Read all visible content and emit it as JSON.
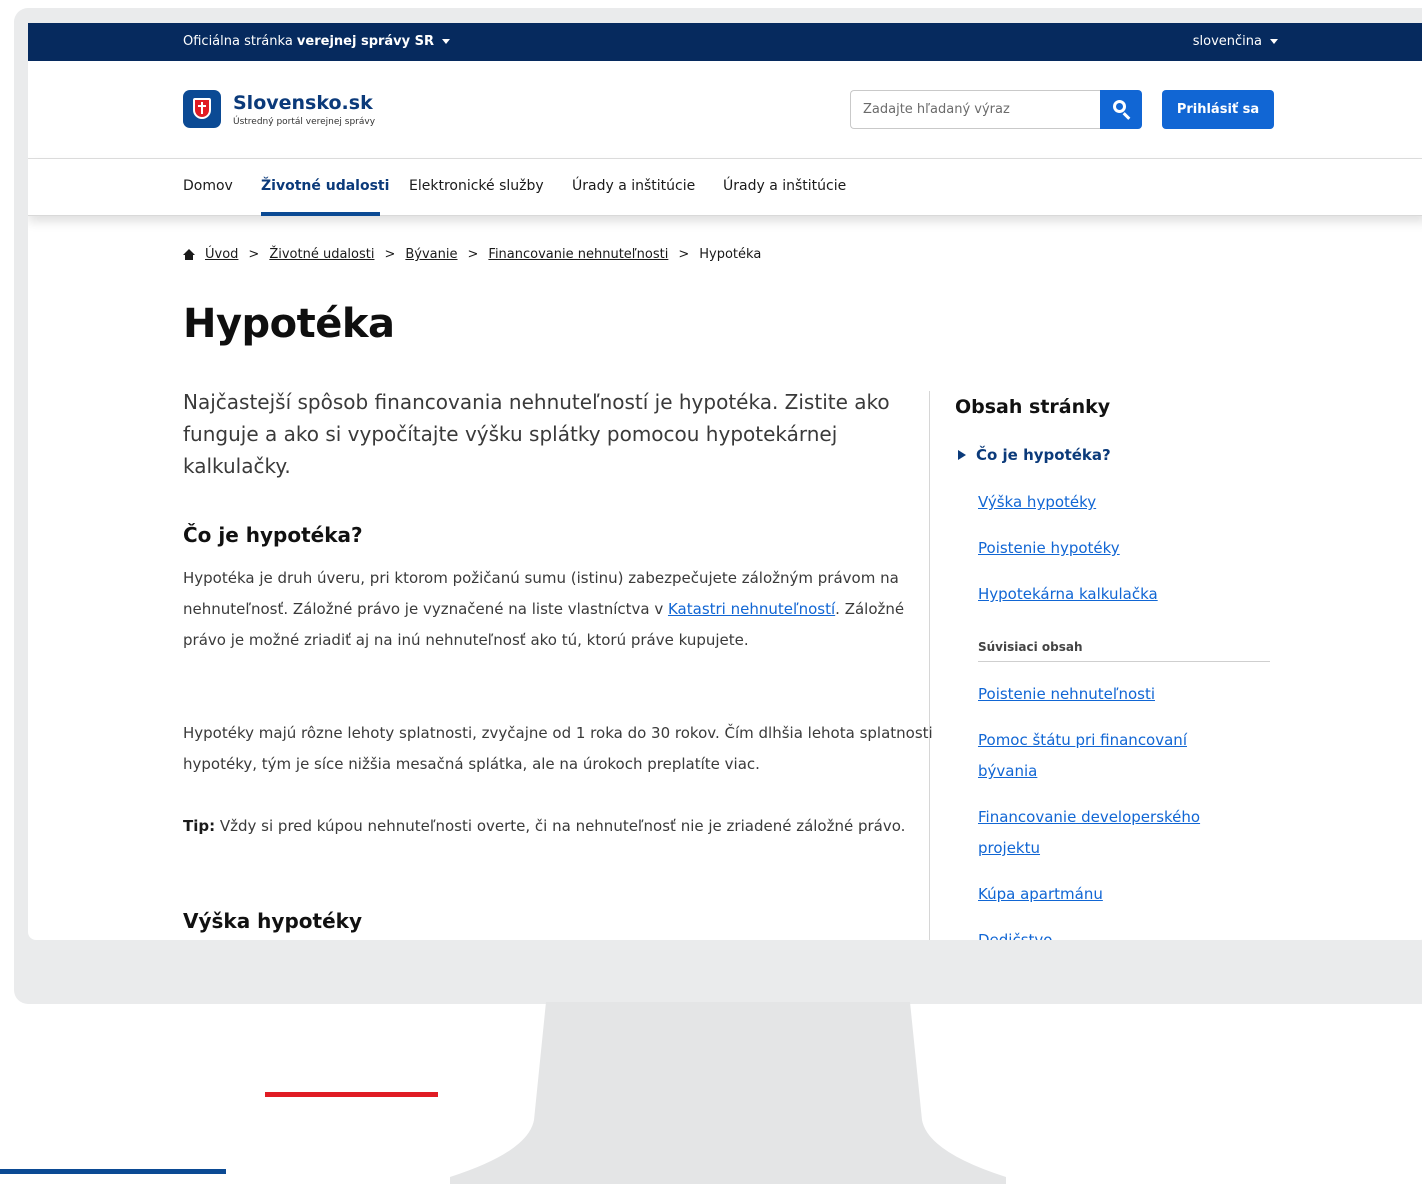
{
  "gov_bar": {
    "prefix": "Oficiálna stránka ",
    "bold": "verejnej správy SR",
    "language": "slovenčina"
  },
  "header": {
    "logo_title": "Slovensko.sk",
    "logo_subtitle": "Ústredný portál verejnej správy",
    "search_placeholder": "Zadajte hľadaný výraz",
    "login_label": "Prihlásiť sa"
  },
  "nav": {
    "items": [
      "Domov",
      "Životné udalosti",
      "Elektronické služby",
      "Úrady a inštitúcie",
      "Úrady a inštitúcie"
    ],
    "active_index": 1
  },
  "breadcrumb": {
    "links": [
      "Úvod",
      "Životné udalosti",
      "Bývanie",
      "Financovanie nehnuteľnosti"
    ],
    "current": "Hypotéka"
  },
  "page": {
    "title": "Hypotéka",
    "lead": "Najčastejší spôsob financovania nehnuteľností je hypotéka. Zistite ako funguje a ako si vypočítajte výšku splátky pomocou hypotekárnej kalkulačky.",
    "section1_heading": "Čo je hypotéka?",
    "p1_before": "Hypotéka je druh úveru, pri ktorom požičanú sumu (istinu) zabezpečujete záložným právom na nehnuteľnosť. Záložné právo je vyznačené na liste vlastníctva v ",
    "p1_link": "Katastri nehnuteľností",
    "p1_after": ". Záložné právo je možné zriadiť aj na inú nehnuteľnosť ako tú, ktorú práve kupujete.",
    "p2": "Hypotéky majú rôzne lehoty splatnosti, zvyčajne od 1 roka do 30 rokov. Čím dlhšia lehota splatnosti hypotéky, tým je síce nižšia mesačná splátka, ale na úrokoch preplatíte viac.",
    "p3_bold": "Tip:",
    "p3": " Vždy si pred kúpou nehnuteľnosti overte, či na nehnuteľnosť nie je zriadené záložné právo.",
    "section2_heading": "Výška hypotéky"
  },
  "toc": {
    "title": "Obsah stránky",
    "current": "Čo je hypotéka?",
    "links": [
      "Výška hypotéky",
      "Poistenie hypotéky",
      "Hypotekárna kalkulačka"
    ],
    "related_title": "Súvisiaci obsah",
    "related": [
      "Poistenie nehnuteľnosti",
      "Pomoc štátu pri financovaní bývania",
      "Financovanie developerského projektu",
      "Kúpa apartmánu",
      "Dedičstvo"
    ]
  },
  "colors": {
    "gov_bar": "#062a5e",
    "primary": "#1166d4",
    "brand_blue": "#0b4a94",
    "accent_red": "#e01c24"
  }
}
